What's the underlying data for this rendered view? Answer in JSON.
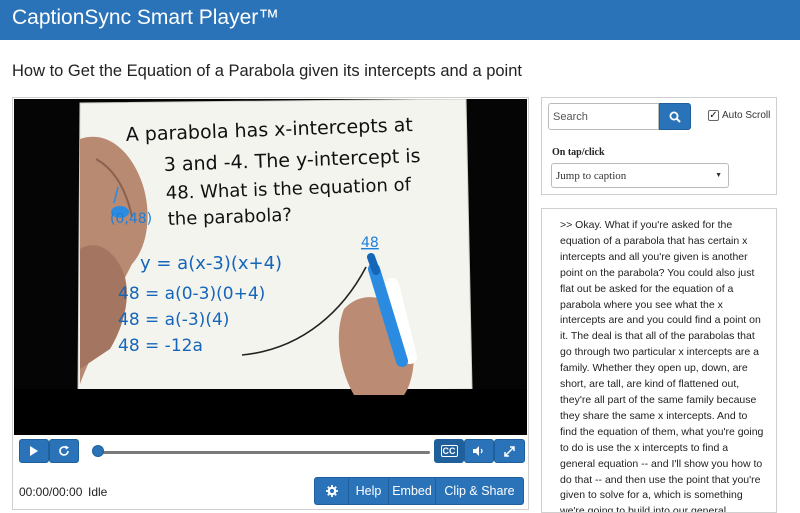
{
  "app": {
    "title": "CaptionSync Smart Player™"
  },
  "video": {
    "title": "How to Get the Equation of a Parabola given its intercepts and a point",
    "whiteboard_lines": [
      "A parabola has x-intercepts at",
      "3 and -4.  The y-intercept is",
      "48.  What is the equation of",
      "the parabola?"
    ],
    "annotation_point": "(0,48)",
    "annotation_value": "48",
    "work_lines": [
      "y = a(x-3)(x+4)",
      "48 = a(0-3)(0+4)",
      "48 = a(-3)(4)",
      "48 = -12a"
    ]
  },
  "player": {
    "time": "00:00/00:00",
    "status": "Idle",
    "progress": 0,
    "buttons": {
      "help": "Help",
      "embed": "Embed",
      "clip_share": "Clip & Share"
    },
    "cc_label": "CC",
    "icons": [
      "play-icon",
      "replay-icon",
      "cc-icon",
      "volume-icon",
      "fullscreen-icon",
      "gear-icon"
    ]
  },
  "search": {
    "placeholder": "Search",
    "autoscroll_label": "Auto Scroll",
    "autoscroll_checked": true,
    "on_tap_label": "On tap/click",
    "on_tap_value": "Jump to caption"
  },
  "transcript": {
    "text": ">> Okay. What if you're asked for the equation of a parabola that has certain x intercepts and all you're given is another point on the parabola? You could also just flat out be asked for the equation of a parabola where you see what the x intercepts are and you could find a point on it. The deal is that all of the parabolas that go through two particular x intercepts are a family. Whether they open up, down, are short, are tall, are kind of flattened out, they're all part of the same family because they share the same x intercepts. And to find the equation of them, what you're going to do is use the x intercepts to find a general equation -- and I'll show you how to do that -- and then use the point that you're given to solve for a, which is something we're going to build into our general equation. Then all"
  }
}
